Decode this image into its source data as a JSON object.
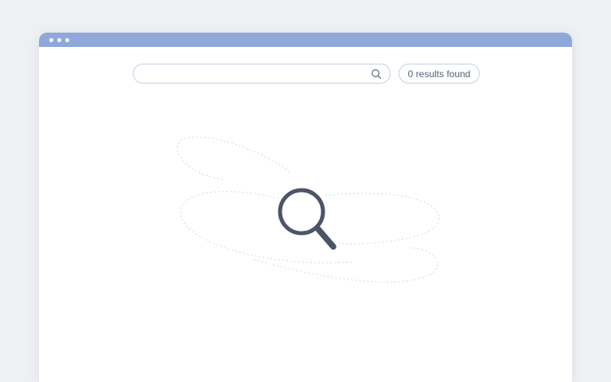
{
  "window": {
    "controls": [
      "dot",
      "dot",
      "dot"
    ],
    "accent_color": "#8fa8d9"
  },
  "search": {
    "value": "",
    "placeholder": "",
    "icon": "search-icon"
  },
  "results": {
    "label": "0 results found"
  },
  "empty_state": {
    "icon": "magnifying-glass-icon",
    "icon_color": "#4b5566"
  }
}
